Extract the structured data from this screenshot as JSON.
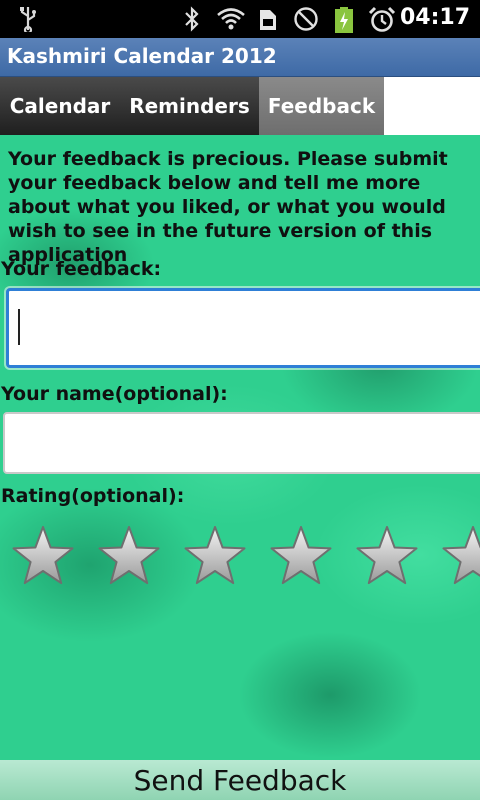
{
  "status_bar": {
    "time": "04:17",
    "icons": [
      "usb-icon",
      "bluetooth-icon",
      "wifi-icon",
      "sd-card-icon",
      "no-sim-icon",
      "battery-charging-icon",
      "alarm-icon"
    ]
  },
  "app": {
    "title": "Kashmiri Calendar 2012"
  },
  "tabs": [
    {
      "label": "Calendar",
      "selected": false
    },
    {
      "label": "Reminders",
      "selected": false
    },
    {
      "label": "Feedback",
      "selected": true
    }
  ],
  "feedback_form": {
    "intro": "Your feedback is precious. Please submit your feedback below and tell me more about what you liked, or what you would wish to see in the future version of this application",
    "feedback_label": "Your feedback:",
    "feedback_value": "",
    "name_label": "Your name(optional):",
    "name_value": "",
    "rating_label": "Rating(optional):",
    "rating": {
      "selected": 0,
      "visible_stars": 6
    },
    "send_label": "Send Feedback"
  }
}
